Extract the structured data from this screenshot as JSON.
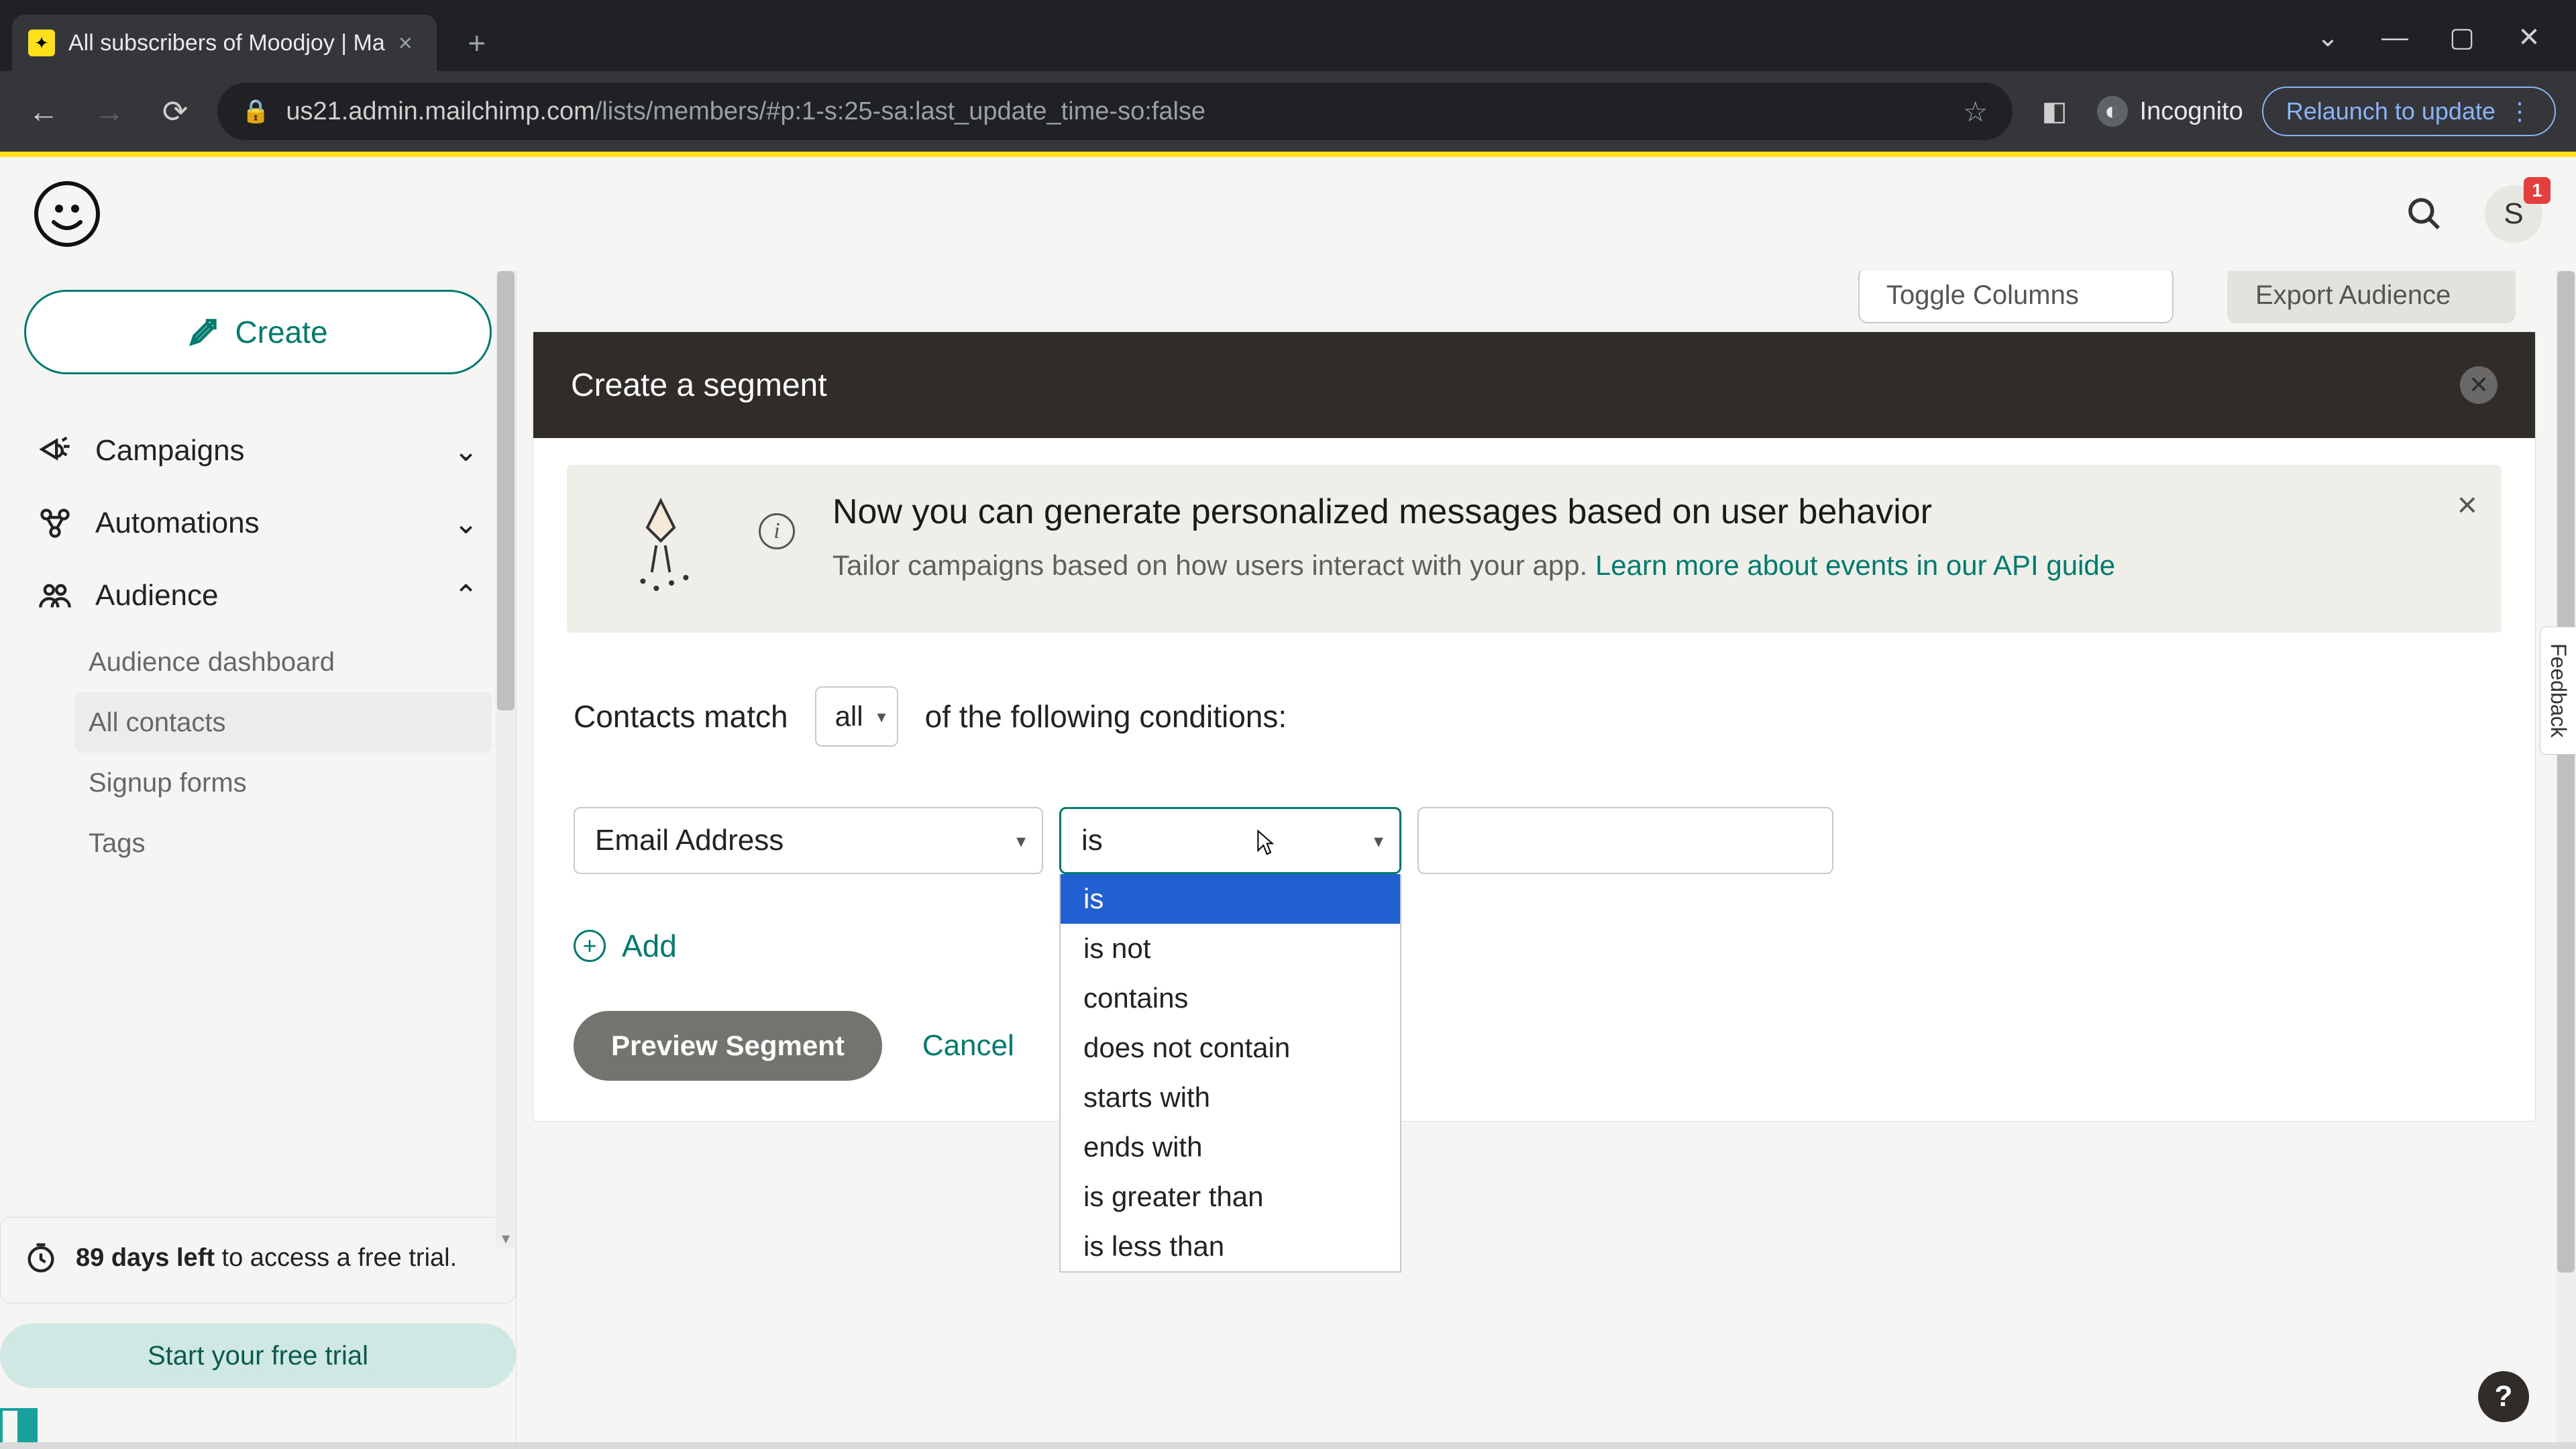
{
  "browser": {
    "tab_title": "All subscribers of Moodjoy | Ma",
    "url_host": "us21.admin.mailchimp.com",
    "url_path": "/lists/members/#p:1-s:25-sa:last_update_time-so:false",
    "incognito_label": "Incognito",
    "relaunch_label": "Relaunch to update"
  },
  "header": {
    "avatar_initial": "S",
    "badge_count": "1"
  },
  "sidebar": {
    "create_label": "Create",
    "items": [
      {
        "label": "Campaigns",
        "expanded": false
      },
      {
        "label": "Automations",
        "expanded": false
      },
      {
        "label": "Audience",
        "expanded": true
      }
    ],
    "audience_sub": [
      "Audience dashboard",
      "All contacts",
      "Signup forms",
      "Tags"
    ],
    "active_sub_index": 1,
    "trial_text_bold": "89 days left",
    "trial_text_rest": " to access a free trial.",
    "trial_button": "Start your free trial"
  },
  "toolbar_over": {
    "toggle_columns": "Toggle Columns",
    "export": "Export Audience"
  },
  "panel": {
    "title": "Create a segment"
  },
  "banner": {
    "headline": "Now you can generate personalized messages based on user behavior",
    "body_prefix": "Tailor campaigns based on how users interact with your app. ",
    "link_text": "Learn more about events in our API guide"
  },
  "builder": {
    "match_prefix": "Contacts match",
    "match_select": "all",
    "match_suffix": "of the following conditions:",
    "field_select": "Email Address",
    "op_select": "is",
    "op_options": [
      "is",
      "is not",
      "contains",
      "does not contain",
      "starts with",
      "ends with",
      "is greater than",
      "is less than"
    ],
    "op_selected_index": 0,
    "value_input": "",
    "add_label": "Add",
    "preview_label": "Preview Segment",
    "cancel_label": "Cancel"
  },
  "feedback_label": "Feedback",
  "help_label": "?"
}
